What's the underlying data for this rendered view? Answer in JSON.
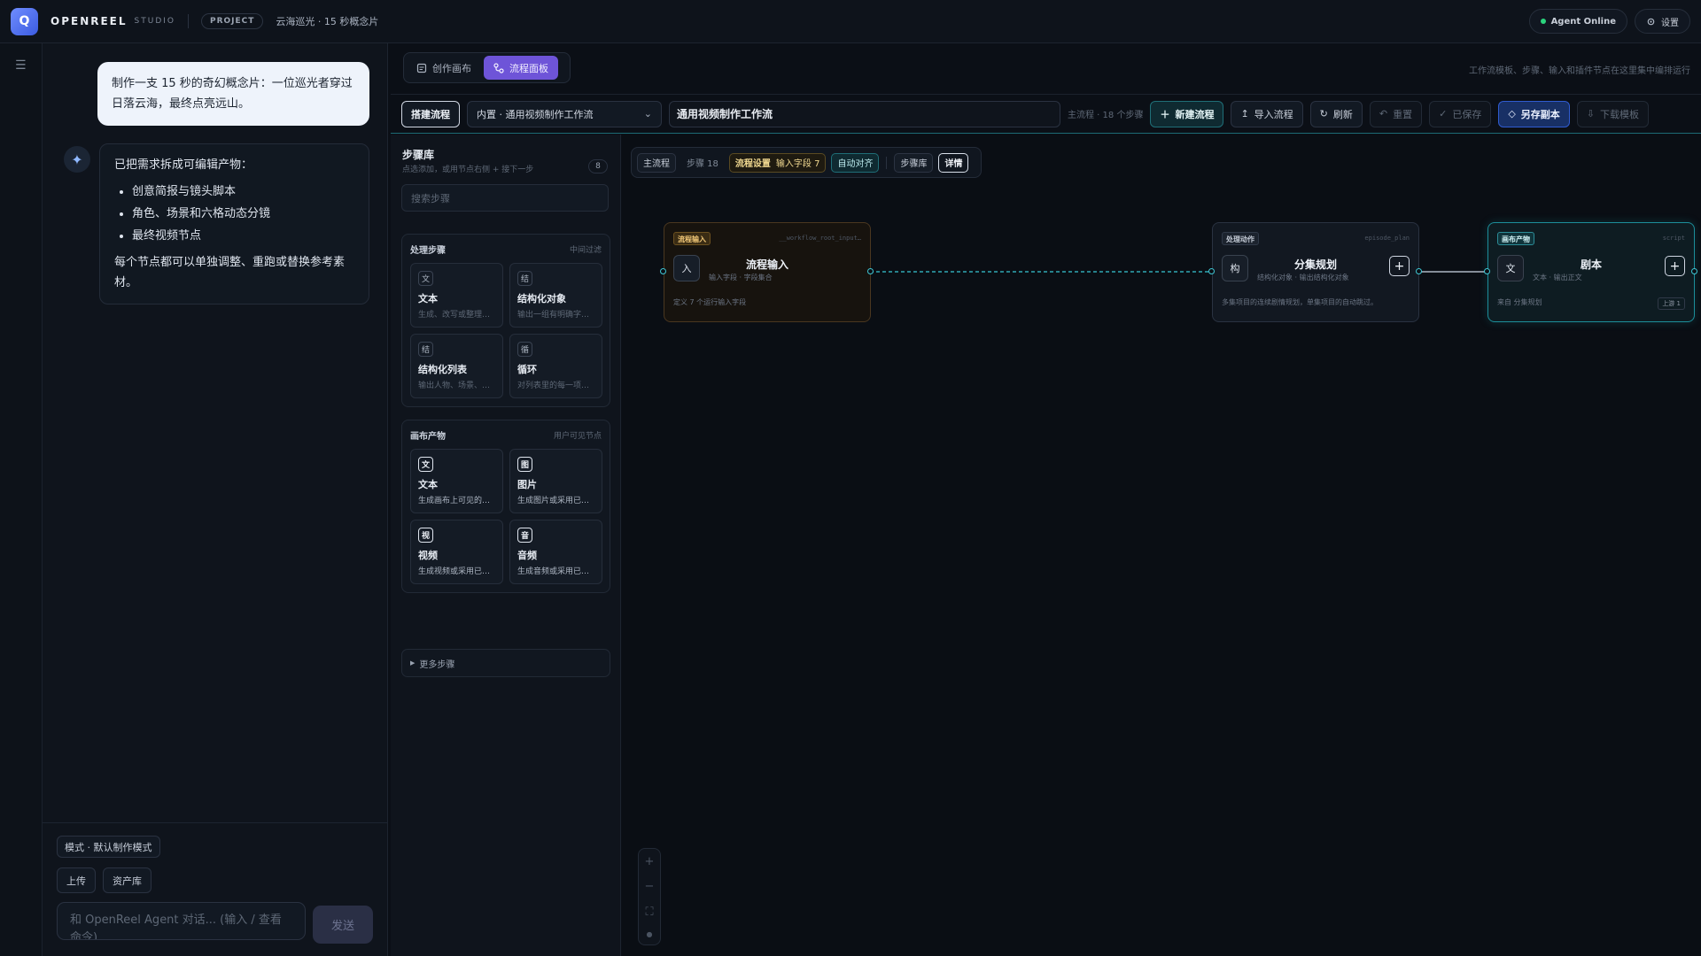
{
  "topbar": {
    "logo_letter": "Q",
    "brand": "OPENREEL",
    "brand_sub": "STUDIO",
    "project_badge": "PROJECT",
    "project_title": "云海巡光 · 15 秒概念片",
    "agent_status": "Agent Online",
    "settings_label": "设置"
  },
  "chat": {
    "user_message": "制作一支 15 秒的奇幻概念片：一位巡光者穿过日落云海，最终点亮远山。",
    "agent_intro": "已把需求拆成可编辑产物：",
    "agent_items": [
      "创意简报与镜头脚本",
      "角色、场景和六格动态分镜",
      "最终视频节点"
    ],
    "agent_outro": "每个节点都可以单独调整、重跑或替换参考素材。",
    "mode_label": "模式 · 默认制作模式",
    "upload_label": "上传",
    "assets_label": "资产库",
    "input_placeholder": "和 OpenReel Agent 对话... (输入 / 查看命令)",
    "send_label": "发送"
  },
  "view_tabs": {
    "canvas_label": "创作画布",
    "flow_label": "流程面板"
  },
  "hint": "工作流模板、步骤、输入和插件节点在这里集中编排运行",
  "toolbar": {
    "build_label": "搭建流程",
    "template_select": "内置 · 通用视频制作工作流",
    "workflow_name": "通用视频制作工作流",
    "meta": "主流程 · 18 个步骤",
    "new_label": "新建流程",
    "import_label": "导入流程",
    "refresh_label": "刷新",
    "reset_label": "重置",
    "saved_label": "已保存",
    "save_copy_label": "另存副本",
    "download_label": "下载模板"
  },
  "library": {
    "title": "步骤库",
    "subtitle": "点选添加，或用节点右侧 + 接下一步",
    "count": "8",
    "search_placeholder": "搜索步骤",
    "process_group": {
      "name": "处理步骤",
      "note": "中间过滤",
      "cards": [
        {
          "icon": "文",
          "title": "文本",
          "desc": "生成、改写或整理…"
        },
        {
          "icon": "结",
          "title": "结构化对象",
          "desc": "输出一组有明确字…"
        },
        {
          "icon": "结",
          "title": "结构化列表",
          "desc": "输出人物、场景、…"
        },
        {
          "icon": "循",
          "title": "循环",
          "desc": "对列表里的每一项…"
        }
      ]
    },
    "canvas_group": {
      "name": "画布产物",
      "note": "用户可见节点",
      "cards": [
        {
          "icon": "文",
          "title": "文本",
          "desc": "生成画布上可见的…"
        },
        {
          "icon": "图",
          "title": "图片",
          "desc": "生成图片或采用已…"
        },
        {
          "icon": "视",
          "title": "视频",
          "desc": "生成视频或采用已…"
        },
        {
          "icon": "音",
          "title": "音频",
          "desc": "生成音频或采用已…"
        }
      ]
    },
    "more_label": "更多步骤"
  },
  "canvas": {
    "controls": {
      "main_flow": "主流程",
      "steps": "步骤 18",
      "settings": "流程设置",
      "input_fields": "输入字段 7",
      "auto_align": "自动对齐",
      "library": "步骤库",
      "details": "详情"
    },
    "nodes": [
      {
        "tag": "流程输入",
        "key": "__workflow_root_input…",
        "icon": "入",
        "title": "流程输入",
        "meta": "输入字段 · 字段集合",
        "foot": "定义 7 个运行输入字段",
        "badge": ""
      },
      {
        "tag": "处理动作",
        "key": "episode_plan",
        "icon": "构",
        "title": "分集规划",
        "meta": "结构化对象 · 输出结构化对象",
        "foot": "多集项目的连续剧情规划，单集项目的自动跳过。",
        "badge": ""
      },
      {
        "tag": "画布产物",
        "key": "script",
        "icon": "文",
        "title": "剧本",
        "meta": "文本 · 输出正文",
        "foot": "来自 分集规划",
        "badge": "上游 1"
      }
    ],
    "zoom": {
      "in": "+",
      "out": "−",
      "fit": "⛶",
      "lock": "●"
    }
  },
  "colors": {
    "accent_purple": "#6e54d8",
    "accent_teal": "#1c8e9a",
    "accent_blue": "#2f5bd0",
    "status_green": "#2bd47d"
  }
}
